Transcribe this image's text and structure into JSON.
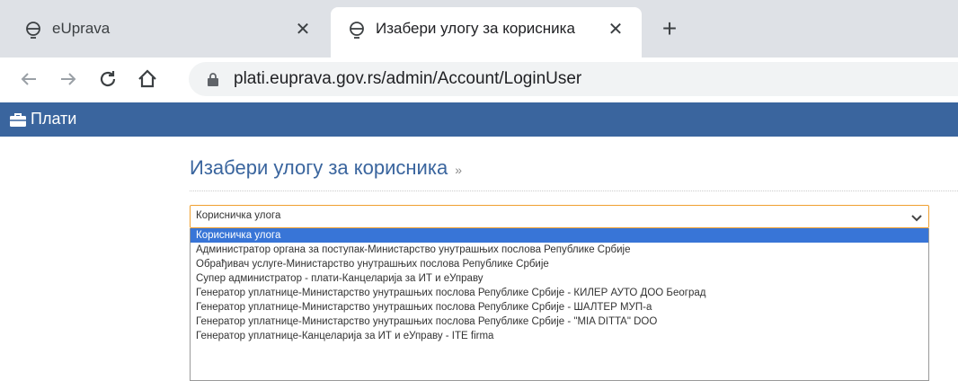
{
  "browser": {
    "tabs": [
      {
        "title": "eUprava",
        "active": false
      },
      {
        "title": "Изабери улогу за корисника",
        "active": true
      }
    ],
    "url": "plati.euprava.gov.rs/admin/Account/LoginUser",
    "icons": {
      "back": "arrow-left-icon",
      "forward": "arrow-right-icon",
      "reload": "reload-icon",
      "home": "home-icon",
      "lock": "lock-icon",
      "close": "close-icon",
      "newtab": "plus-icon"
    }
  },
  "app": {
    "brand": "Плати",
    "brand_icon": "briefcase-icon",
    "accent_color": "#3a659e"
  },
  "page": {
    "title": "Изабери улогу за корисника",
    "title_suffix": "»"
  },
  "role_select": {
    "selected": "Корисничка улога",
    "options": [
      "Корисничка улога",
      "Администратор органа за поступак-Министарство унутрашњих послова Републике Србије",
      "Обрађивач услуге-Министарство унутрашњих послова Републике Србије",
      "Супер администратор - плати-Канцеларија за ИТ и еУправу",
      "Генератор уплатнице-Министарство унутрашњих послова Републике Србије - КИЛЕР АУТО ДОО Београд",
      "Генератор уплатнице-Министарство унутрашњих послова Републике Србије - ШАЛТЕР МУП-а",
      "Генератор уплатнице-Министарство унутрашњих послова Републике Србије - \"MIA DITTA\" DOO",
      "Генератор уплатнице-Канцеларија за ИТ и еУправу - ITE firma"
    ]
  }
}
